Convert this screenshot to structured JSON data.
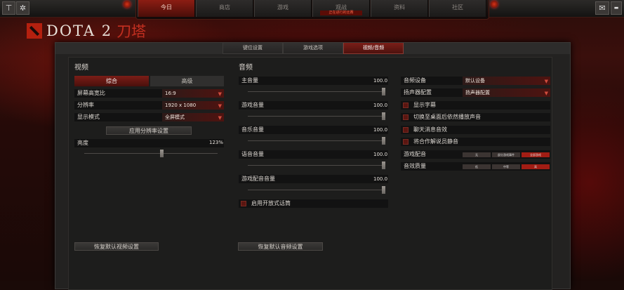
{
  "topnav": {
    "tabs": [
      "今日",
      "商店",
      "游戏",
      "观战",
      "资料",
      "社区"
    ],
    "active_index": 0,
    "sub_label": "正在进行的比赛"
  },
  "logo": {
    "text": "DOTA 2",
    "cn": "刀塔"
  },
  "settings_tabs": [
    "键位设置",
    "游戏选项",
    "视频/音频"
  ],
  "settings_active": 2,
  "video": {
    "title": "视频",
    "seg_general": "综合",
    "seg_advanced": "高级",
    "aspect_label": "屏幕高宽比",
    "aspect_value": "16:9",
    "resolution_label": "分辨率",
    "resolution_value": "1920 x 1080",
    "display_label": "显示模式",
    "display_value": "全屏模式",
    "apply_btn": "应用分辨率设置",
    "brightness_label": "亮度",
    "brightness_value": "123%",
    "brightness_level": 0.58,
    "reset_btn": "恢复默认视频设置"
  },
  "audio": {
    "title": "音频",
    "sliders": [
      {
        "label": "主音量",
        "value": "100.0"
      },
      {
        "label": "游戏音量",
        "value": "100.0"
      },
      {
        "label": "音乐音量",
        "value": "100.0"
      },
      {
        "label": "语音音量",
        "value": "100.0"
      },
      {
        "label": "游戏配音音量",
        "value": "100.0"
      }
    ],
    "open_mic_label": "启用开放式话筒",
    "reset_btn": "恢复默认音频设置"
  },
  "audio_right": {
    "device_label": "音频设备",
    "device_value": "默认设备",
    "speaker_label": "扬声器配置",
    "speaker_value": "扬声器配置",
    "checks": [
      "显示字幕",
      "切换至桌面后依然播放声音",
      "聊天消息音效",
      "将合作解说员静音"
    ],
    "announcer_label": "游戏配音",
    "announcer_opts": [
      "无",
      "部分游戏事件",
      "全部游戏"
    ],
    "quality_label": "音效质量",
    "quality_opts": [
      "低",
      "中等",
      "高"
    ]
  }
}
